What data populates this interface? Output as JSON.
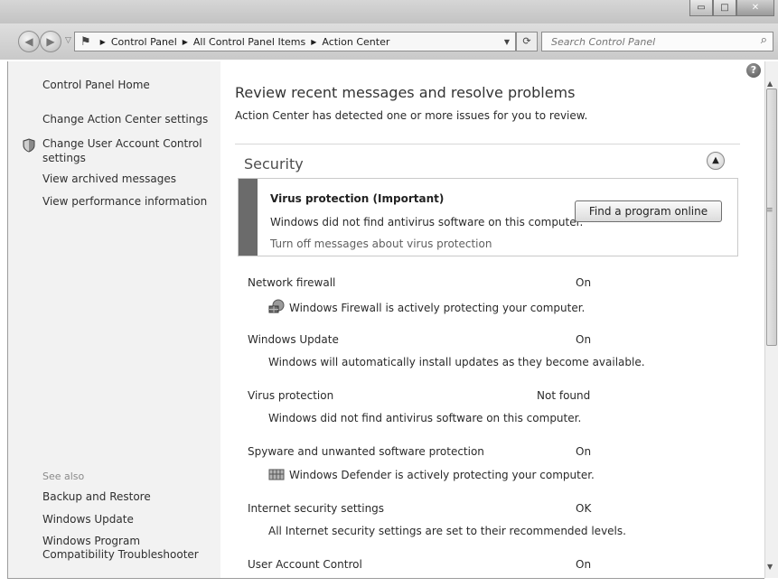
{
  "window": {
    "controls": {
      "minimize": "▭",
      "maximize": "□",
      "close": "✕"
    }
  },
  "nav": {
    "breadcrumbs": [
      "Control Panel",
      "All Control Panel Items",
      "Action Center"
    ],
    "search_placeholder": "Search Control Panel",
    "icons": {
      "back": "arrow-left",
      "forward": "arrow-right",
      "refresh": "refresh",
      "search": "magnifier",
      "location": "flag"
    }
  },
  "sidebar": {
    "home": "Control Panel Home",
    "links": [
      "Change Action Center settings",
      "Change User Account Control settings",
      "View archived messages",
      "View performance information"
    ],
    "see_also_label": "See also",
    "see_also": [
      "Backup and Restore",
      "Windows Update",
      "Windows Program Compatibility Troubleshooter"
    ]
  },
  "main": {
    "heading": "Review recent messages and resolve problems",
    "subheading": "Action Center has detected one or more issues for you to review.",
    "section_title": "Security",
    "alert": {
      "title": "Virus protection (Important)",
      "description": "Windows did not find antivirus software on this computer.",
      "link": "Turn off messages about virus protection",
      "button": "Find a program online"
    },
    "items": [
      {
        "name": "Network firewall",
        "status": "On",
        "description": "Windows Firewall is actively protecting your computer.",
        "icon": "firewall-icon"
      },
      {
        "name": "Windows Update",
        "status": "On",
        "description": "Windows will automatically install updates as they become available."
      },
      {
        "name": "Virus protection",
        "status": "Not found",
        "description": "Windows did not find antivirus software on this computer."
      },
      {
        "name": "Spyware and unwanted software protection",
        "status": "On",
        "description": "Windows Defender is actively protecting your computer.",
        "icon": "defender-icon"
      },
      {
        "name": "Internet security settings",
        "status": "OK",
        "description": "All Internet security settings are set to their recommended levels."
      },
      {
        "name": "User Account Control",
        "status": "On",
        "description": ""
      }
    ]
  },
  "colors": {
    "alert_strip": "#6b6b6b",
    "sidebar_bg": "#f2f2f2"
  }
}
